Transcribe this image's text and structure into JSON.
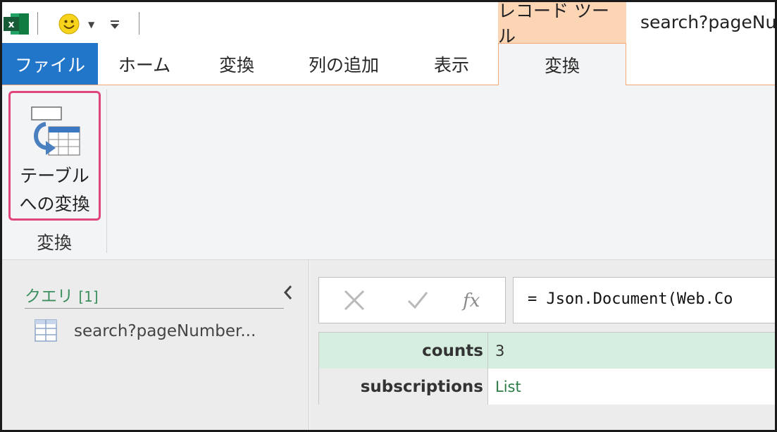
{
  "titlebar": {
    "context_tab_label": "レコード ツール",
    "window_title": "search?pageNu"
  },
  "tabs": [
    {
      "label": "ファイル"
    },
    {
      "label": "ホーム"
    },
    {
      "label": "変換"
    },
    {
      "label": "列の追加"
    },
    {
      "label": "表示"
    },
    {
      "label": "変換"
    }
  ],
  "ribbon": {
    "convert_button_line1": "テーブル",
    "convert_button_line2": "への変換",
    "group_label": "変換"
  },
  "queries": {
    "title": "クエリ",
    "count": "[1]",
    "items": [
      {
        "label": "search?pageNumber..."
      }
    ]
  },
  "formula_bar": {
    "formula": "= Json.Document(Web.Co"
  },
  "record": {
    "rows": [
      {
        "key": "counts",
        "value": "3"
      },
      {
        "key": "subscriptions",
        "value": "List"
      }
    ]
  },
  "colors": {
    "file_tab": "#2176c9",
    "context_tab": "#fcd5b5",
    "highlight": "#e0457b",
    "query_green": "#3d8f5e"
  },
  "icons": {
    "app": "excel-icon",
    "feedback": "smiley-icon",
    "convert": "table-convert-icon",
    "query": "table-icon",
    "cancel": "cross-icon",
    "commit": "check-icon",
    "function": "fx-icon",
    "collapse": "chevron-left-icon"
  }
}
